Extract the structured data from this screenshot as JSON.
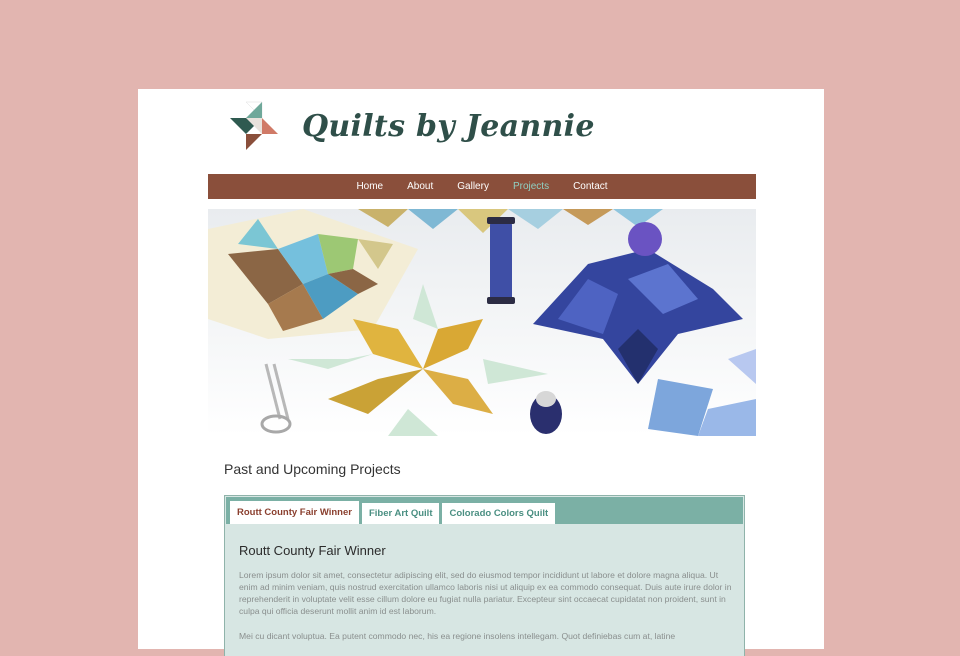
{
  "site": {
    "title": "Quilts by Jeannie"
  },
  "nav": {
    "items": [
      "Home",
      "About",
      "Gallery",
      "Projects",
      "Contact"
    ],
    "active": "Projects"
  },
  "hero": {
    "description": "Photo of quilt pieces, spools of thread, a pin cushion, scissors and a thimble"
  },
  "section": {
    "heading": "Past and Upcoming Projects"
  },
  "tabs": {
    "items": [
      "Routt County Fair Winner",
      "Fiber Art Quilt",
      "Colorado Colors Quilt"
    ],
    "active": "Routt County Fair Winner"
  },
  "panel": {
    "title": "Routt County Fair Winner",
    "paragraph1": "Lorem ipsum dolor sit amet, consectetur adipiscing elit, sed do eiusmod tempor incididunt ut labore et dolore magna aliqua. Ut enim ad minim veniam, quis nostrud exercitation ullamco laboris nisi ut aliquip ex ea commodo consequat. Duis aute irure dolor in reprehenderit in voluptate velit esse cillum dolore eu fugiat nulla pariatur. Excepteur sint occaecat cupidatat non proident, sunt in culpa qui officia deserunt mollit anim id est laborum.",
    "paragraph2": "Mei cu dicant voluptua. Ea putent commodo nec, his ea regione insolens intellegam. Quot definiebas cum at, latine"
  },
  "colors": {
    "background": "#e2b5b0",
    "nav": "#8a4f3b",
    "nav_active": "#8fd0c3",
    "title": "#2f4f49",
    "tab_bar": "#7bb0a5",
    "panel": "#d7e6e3",
    "active_tab_text": "#8a3f2e"
  }
}
